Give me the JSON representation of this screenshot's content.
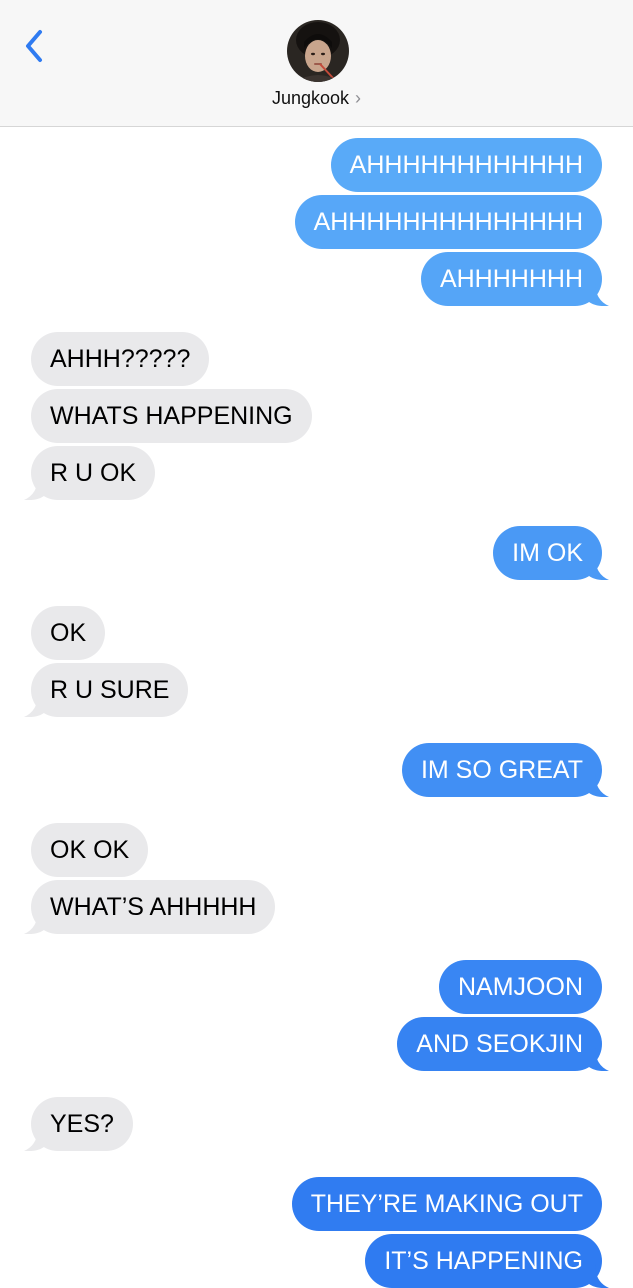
{
  "header": {
    "contact_name": "Jungkook",
    "chevron": "›"
  },
  "colors": {
    "sent_bubble_top": "#5fb0f9",
    "sent_bubble_bottom": "#2f7bf1",
    "received_bubble": "#e9e9eb",
    "accent": "#2f7bf1"
  },
  "icons": {
    "back": "chevron-left-icon",
    "contact_detail": "chevron-right-icon"
  },
  "messages": [
    {
      "dir": "sent",
      "text": "AHHHHHHHHHHHH"
    },
    {
      "dir": "sent",
      "text": "AHHHHHHHHHHHHHH"
    },
    {
      "dir": "sent",
      "text": "AHHHHHHH"
    },
    {
      "dir": "received",
      "text": "AHHH?????"
    },
    {
      "dir": "received",
      "text": "WHATS HAPPENING"
    },
    {
      "dir": "received",
      "text": "R U OK"
    },
    {
      "dir": "sent",
      "text": "IM OK"
    },
    {
      "dir": "received",
      "text": "OK"
    },
    {
      "dir": "received",
      "text": "R U SURE"
    },
    {
      "dir": "sent",
      "text": "IM SO GREAT"
    },
    {
      "dir": "received",
      "text": "OK OK"
    },
    {
      "dir": "received",
      "text": "WHAT’S AHHHHH"
    },
    {
      "dir": "sent",
      "text": "NAMJOON"
    },
    {
      "dir": "sent",
      "text": "AND SEOKJIN"
    },
    {
      "dir": "received",
      "text": "YES?"
    },
    {
      "dir": "sent",
      "text": "THEY’RE MAKING OUT"
    },
    {
      "dir": "sent",
      "text": "IT’S HAPPENING"
    }
  ]
}
